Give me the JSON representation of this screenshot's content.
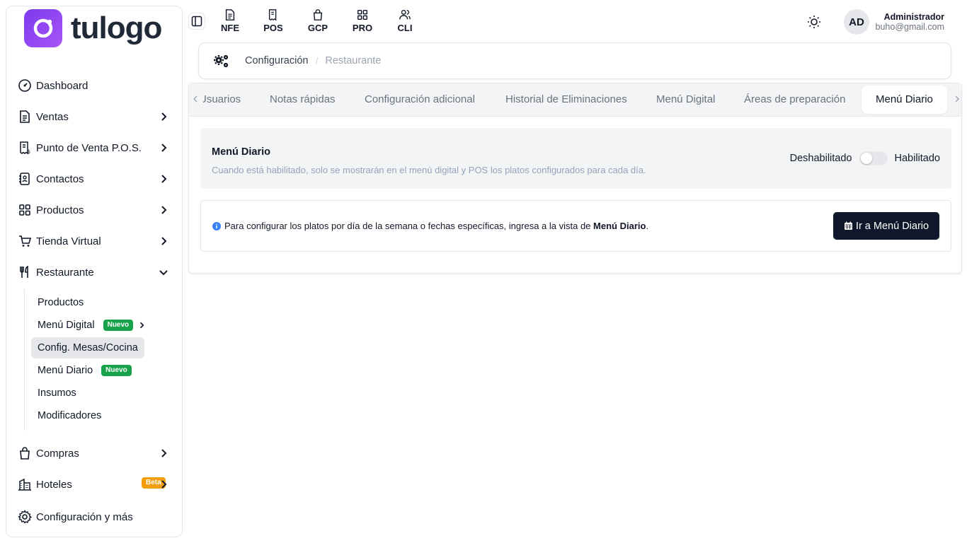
{
  "brand": {
    "name": "tulogo",
    "accent": "#7c3aed"
  },
  "sidebar": {
    "items": [
      {
        "label": "Dashboard",
        "icon": "gauge-icon"
      },
      {
        "label": "Ventas",
        "icon": "document-icon"
      },
      {
        "label": "Punto de Venta P.O.S.",
        "icon": "receipt-icon"
      },
      {
        "label": "Contactos",
        "icon": "contacts-icon"
      },
      {
        "label": "Productos",
        "icon": "grid-icon"
      },
      {
        "label": "Tienda Virtual",
        "icon": "cart-icon"
      },
      {
        "label": "Restaurante",
        "icon": "utensils-icon"
      },
      {
        "label": "Compras",
        "icon": "bag-icon"
      },
      {
        "label": "Hoteles",
        "icon": "building-icon",
        "badge": "Beta"
      },
      {
        "label": "Configuración y más",
        "icon": "gear-icon"
      }
    ],
    "restaurant_sub": [
      {
        "label": "Productos"
      },
      {
        "label": "Menú Digital",
        "badge": "Nuevo"
      },
      {
        "label": "Config. Mesas/Cocina"
      },
      {
        "label": "Menú Diario",
        "badge": "Nuevo"
      },
      {
        "label": "Insumos"
      },
      {
        "label": "Modificadores"
      }
    ]
  },
  "topbar": {
    "shortcuts": [
      "NFE",
      "POS",
      "GCP",
      "PRO",
      "CLI"
    ],
    "user": {
      "initials": "AD",
      "name": "Administrador",
      "email": "buho@gmail.com"
    }
  },
  "breadcrumb": {
    "section": "Configuración",
    "separator": "/",
    "current": "Restaurante"
  },
  "tabs": [
    "Usuarios",
    "Notas rápidas",
    "Configuración adicional",
    "Historial de Eliminaciones",
    "Menú Digital",
    "Áreas de preparación",
    "Menú Diario"
  ],
  "active_tab": "Menú Diario",
  "setting": {
    "title": "Menú Diario",
    "description": "Cuando está habilitado, solo se mostrarán en el menú digital y POS los platos configurados para cada día.",
    "off_label": "Deshabilitado",
    "on_label": "Habilitado",
    "enabled": false
  },
  "info": {
    "text": "Para configurar los platos por día de la semana o fechas específicas, ingresa a la vista de",
    "link_text": "Menú Diario",
    "end": ".",
    "button_label": "Ir a Menú Diario"
  }
}
